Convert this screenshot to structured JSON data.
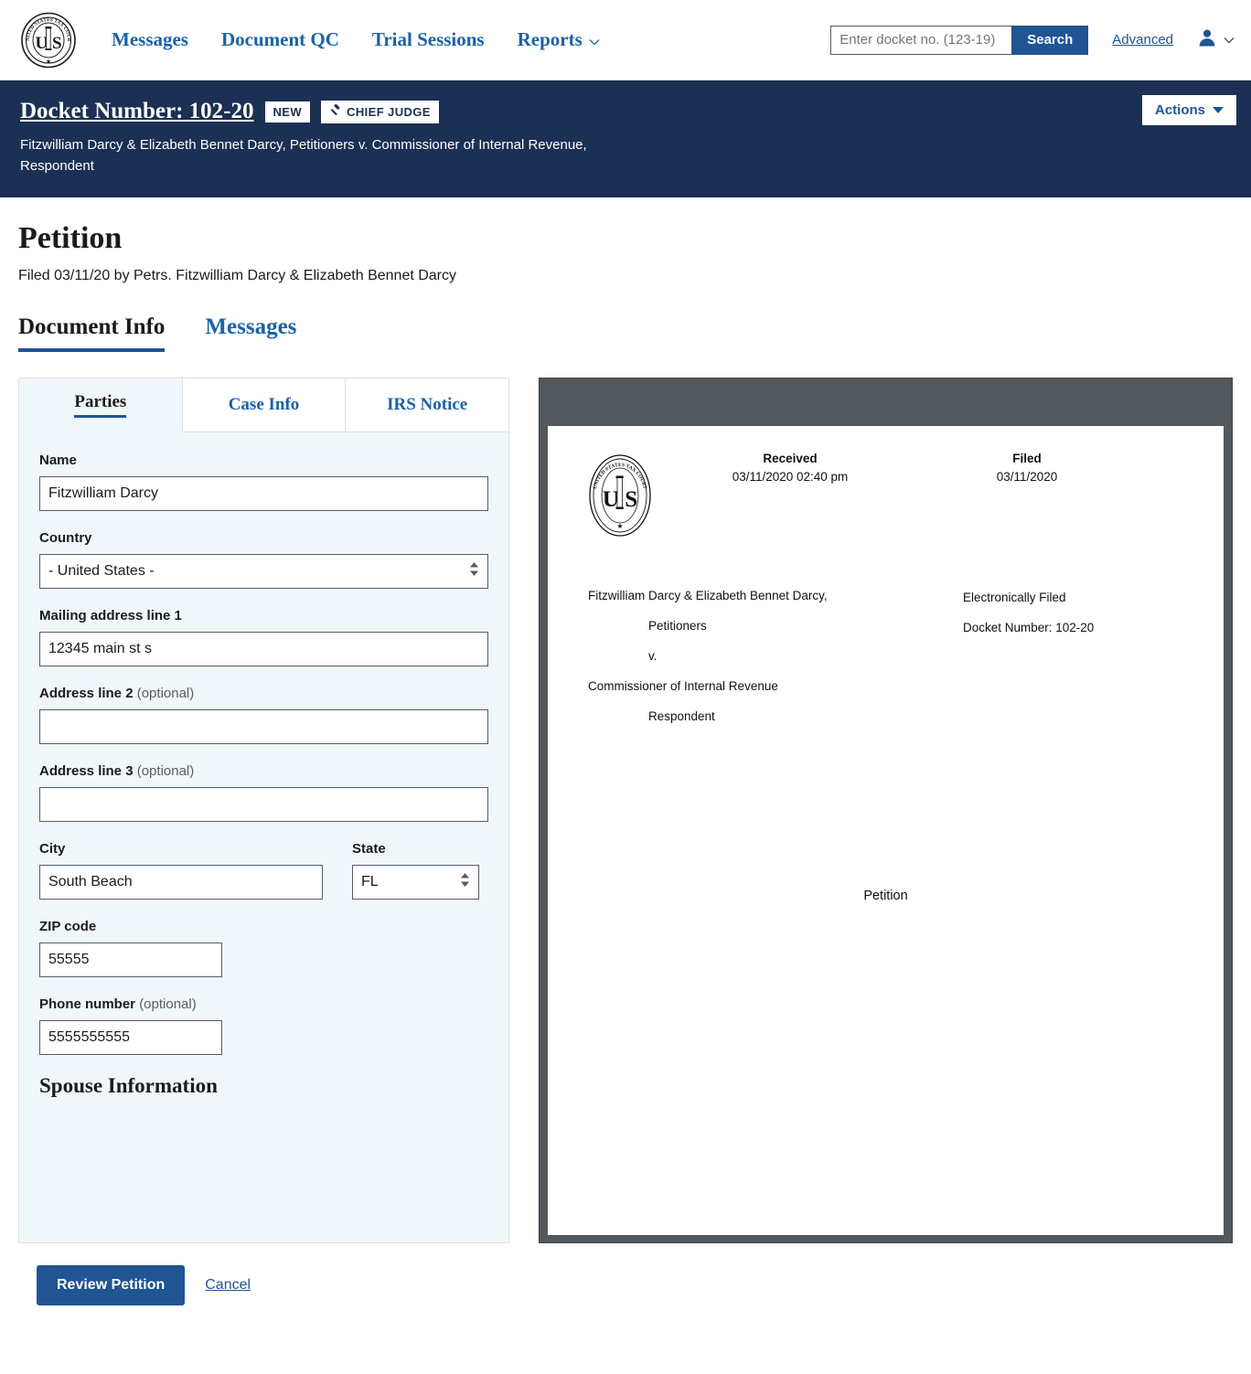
{
  "header": {
    "logo_alt": "United States Tax Court Seal",
    "nav": [
      {
        "label": "Messages",
        "icon": ""
      },
      {
        "label": "Document QC",
        "icon": ""
      },
      {
        "label": "Trial Sessions",
        "icon": ""
      },
      {
        "label": "Reports",
        "icon": "chevron-down-icon"
      }
    ],
    "search": {
      "placeholder": "Enter docket no. (123-19)",
      "value": "",
      "button_label": "Search",
      "advanced_label": "Advanced"
    },
    "account_icon": "user-icon"
  },
  "banner": {
    "docket_title": "Docket Number: 102-20",
    "badge_new": "NEW",
    "badge_chief_judge": "CHIEF JUDGE",
    "case_caption": "Fitzwilliam Darcy & Elizabeth Bennet Darcy, Petitioners v. Commissioner of Internal Revenue, Respondent",
    "actions_label": "Actions",
    "background_color": "#1b3054"
  },
  "page": {
    "title": "Petition",
    "filed_line": "Filed 03/11/20 by Petrs. Fitzwilliam Darcy & Elizabeth Bennet Darcy",
    "main_tabs": [
      {
        "label": "Document Info",
        "active": true
      },
      {
        "label": "Messages",
        "active": false
      }
    ]
  },
  "form": {
    "tabs": [
      {
        "label": "Parties",
        "active": true
      },
      {
        "label": "Case Info",
        "active": false
      },
      {
        "label": "IRS Notice",
        "active": false
      }
    ],
    "fields": {
      "name_label": "Name",
      "name_value": "Fitzwilliam Darcy",
      "country_label": "Country",
      "country_value": "- United States -",
      "address1_label": "Mailing address line 1",
      "address1_value": "12345 main st s",
      "address2_label": "Address line 2",
      "address2_optional": "(optional)",
      "address2_value": "",
      "address3_label": "Address line 3",
      "address3_optional": "(optional)",
      "address3_value": "",
      "city_label": "City",
      "city_value": "South Beach",
      "state_label": "State",
      "state_value": "FL",
      "zip_label": "ZIP code",
      "zip_value": "55555",
      "phone_label": "Phone number",
      "phone_optional": "(optional)",
      "phone_value": "5555555555",
      "spouse_heading": "Spouse Information"
    }
  },
  "document_preview": {
    "received_label": "Received",
    "received_value": "03/11/2020 02:40 pm",
    "filed_label": "Filed",
    "filed_value": "03/11/2020",
    "caption_petitioners": "Fitzwilliam Darcy & Elizabeth Bennet Darcy,",
    "caption_petitioners_role": "Petitioners",
    "caption_versus": "v.",
    "caption_respondent_name": "Commissioner of Internal Revenue",
    "caption_respondent_role": "Respondent",
    "efile_label": "Electronically Filed",
    "docket_label": "Docket Number: 102-20",
    "body_title": "Petition",
    "toolbar_color": "#53585c"
  },
  "footer": {
    "primary_label": "Review Petition",
    "cancel_label": "Cancel"
  }
}
